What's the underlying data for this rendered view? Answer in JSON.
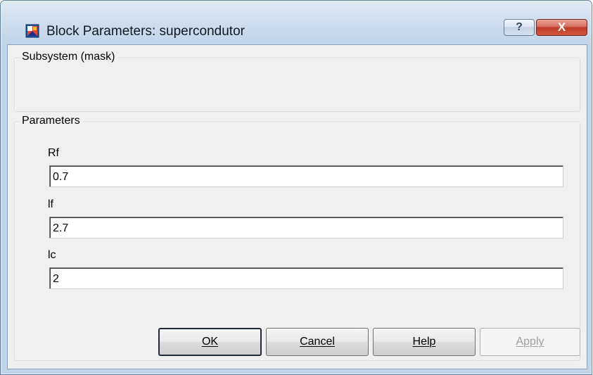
{
  "window": {
    "title": "Block Parameters: supercondutor",
    "icon": "simulink-block-icon",
    "help_button": "?",
    "close_button": "X"
  },
  "mask_group": {
    "label": "Subsystem (mask)"
  },
  "parameters_group": {
    "label": "Parameters",
    "fields": [
      {
        "label": "Rf",
        "value": "0.7"
      },
      {
        "label": "lf",
        "value": "2.7"
      },
      {
        "label": "lc",
        "value": "2"
      }
    ]
  },
  "buttons": {
    "ok": "OK",
    "cancel": "Cancel",
    "help": "Help",
    "apply": "Apply"
  },
  "colors": {
    "frame": "#c3d5e9",
    "close": "#c9473a",
    "client": "#f0f0f0"
  }
}
